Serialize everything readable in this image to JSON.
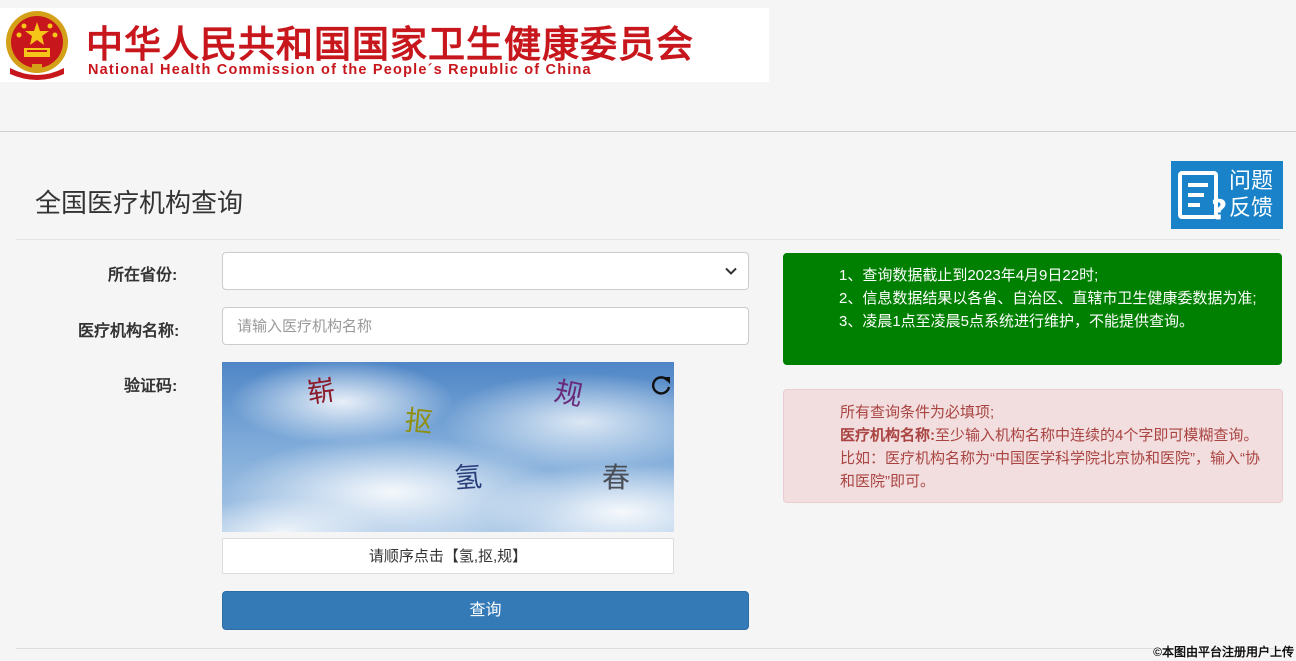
{
  "header": {
    "name_cn": "中华人民共和国国家卫生健康委员会",
    "name_en": "National Health Commission of the People´s Republic of China"
  },
  "page": {
    "title": "全国医疗机构查询",
    "feedback_label": "问题反馈",
    "feedback_line1": "问题",
    "feedback_line2": "反馈"
  },
  "form": {
    "province_label": "所在省份:",
    "province_value": "",
    "name_label": "医疗机构名称:",
    "name_placeholder": "请输入医疗机构名称",
    "name_value": "",
    "captcha_label": "验证码:",
    "captcha_chars": [
      {
        "char": "崭",
        "color": "#8b1a2a",
        "rotate": -8
      },
      {
        "char": "抠",
        "color": "#8f8f10",
        "rotate": 6
      },
      {
        "char": "规",
        "color": "#6a2a7a",
        "rotate": 12
      },
      {
        "char": "氢",
        "color": "#2a3f7a",
        "rotate": -4
      },
      {
        "char": "春",
        "color": "#4a4f57",
        "rotate": 0
      }
    ],
    "captcha_hint": "请顺序点击【氢,抠,规】",
    "submit_label": "查询"
  },
  "notices": {
    "green": [
      "1、查询数据截止到2023年4月9日22时;",
      "2、信息数据结果以各省、自治区、直辖市卫生健康委数据为准;",
      "3、凌晨1点至凌晨5点系统进行维护，不能提供查询。"
    ],
    "red_intro": "所有查询条件为必填项;",
    "red_bold": "医疗机构名称:",
    "red_text": "至少输入机构名称中连续的4个字即可模糊查询。比如：医疗机构名称为“中国医学科学院北京协和医院”，输入“协和医院”即可。"
  },
  "watermark": "©本图由平台注册用户上传",
  "colors": {
    "brand_red": "#c8161d",
    "primary_button": "#337ab7",
    "notice_green": "#008000",
    "notice_red_bg": "#f2dede",
    "notice_red_text": "#a94442",
    "feedback_blue": "#1a82c8"
  }
}
